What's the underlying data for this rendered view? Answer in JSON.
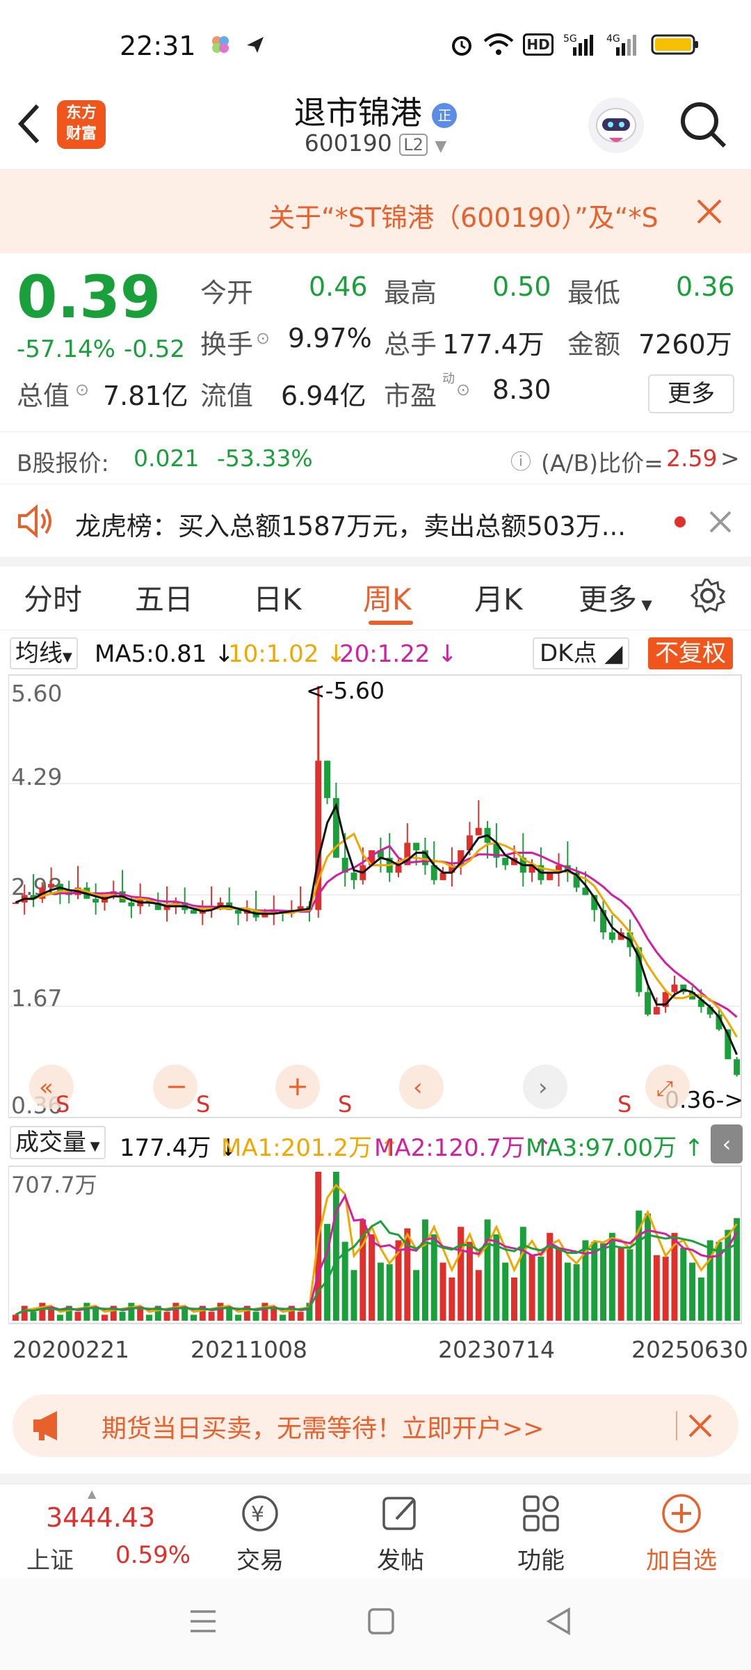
{
  "status": {
    "time": "22:31"
  },
  "header": {
    "title": "退市锦港",
    "title_badge": "正",
    "code": "600190",
    "level_badge": "L2",
    "logo_line1": "东方",
    "logo_line2": "财富"
  },
  "notice": {
    "text": "关于“*ST锦港（600190）”及“*S"
  },
  "quote": {
    "price": "0.39",
    "change_pct": "-57.14%",
    "change_abs": "-0.52",
    "open_label": "今开",
    "open": "0.46",
    "high_label": "最高",
    "high": "0.50",
    "low_label": "最低",
    "low": "0.36",
    "turnover_label": "换手",
    "turnover": "9.97%",
    "volume_label": "总手",
    "volume": "177.4万",
    "amount_label": "金额",
    "amount": "7260万",
    "mktcap_label": "总值",
    "mktcap": "7.81亿",
    "float_label": "流值",
    "float": "6.94亿",
    "pe_label": "市盈",
    "pe_sup": "动",
    "pe": "8.30",
    "more": "更多"
  },
  "bshare": {
    "label": "B股报价:",
    "price": "0.021",
    "pct": "-53.33%",
    "ratio_label": "(A/B)比价=",
    "ratio": "2.59",
    "arrow": ">"
  },
  "dragon": {
    "text": "龙虎榜：买入总额1587万元，卖出总额503万..."
  },
  "tabs": [
    "分时",
    "五日",
    "日K",
    "周K",
    "月K",
    "更多"
  ],
  "ma": {
    "selector": "均线",
    "ma5": "MA5:0.81",
    "ma10": "10:1.02",
    "ma20": "20:1.22",
    "dk": "DK点",
    "adjust": "不复权"
  },
  "chart_labels": {
    "y_top": "5.60",
    "y2": "4.29",
    "y3": "2.98",
    "y4": "1.67",
    "y_bot": "0.36",
    "peak": "<-5.60",
    "trough": "0.36->",
    "s_marker": "S"
  },
  "vol": {
    "selector": "成交量",
    "value": "177.4万",
    "ma1": "MA1:201.2万",
    "ma2": "MA2:120.7万",
    "ma3": "MA3:97.00万",
    "max": "707.7万"
  },
  "dates": [
    "20200221",
    "20211008",
    "20230714",
    "20250630"
  ],
  "ad": {
    "text": "期货当日买卖，无需等待！立即开户>>"
  },
  "index": {
    "value": "3444.43",
    "name": "上证",
    "pct": "0.59%"
  },
  "nav": [
    "交易",
    "发帖",
    "功能",
    "加自选"
  ],
  "colors": {
    "accent": "#e8602c",
    "up": "#e0302b",
    "down": "#1aa03a",
    "ma5": "#111111",
    "ma10": "#f0a800",
    "ma20": "#d01fa0"
  },
  "chart_data": {
    "type": "candlestick",
    "title": "退市锦港 周K",
    "ylim": [
      0.36,
      5.6
    ],
    "y_ticks": [
      5.6,
      4.29,
      2.98,
      1.67,
      0.36
    ],
    "x_ticks": [
      "20200221",
      "20211008",
      "20230714",
      "20250630"
    ],
    "series": [
      {
        "name": "close",
        "values": [
          2.7,
          2.8,
          2.75,
          2.9,
          2.95,
          2.85,
          2.8,
          2.9,
          2.75,
          2.7,
          2.8,
          2.85,
          2.7,
          2.65,
          2.75,
          2.7,
          2.6,
          2.65,
          2.7,
          2.6,
          2.55,
          2.6,
          2.65,
          2.7,
          2.6,
          2.55,
          2.6,
          2.5,
          2.55,
          2.6,
          2.55,
          2.6,
          2.65,
          2.6,
          4.6,
          4.1,
          3.3,
          3.1,
          3.0,
          3.2,
          3.4,
          3.3,
          3.1,
          3.2,
          3.5,
          3.4,
          3.2,
          3.0,
          3.1,
          3.2,
          3.4,
          3.6,
          3.7,
          3.5,
          3.3,
          3.2,
          3.3,
          3.1,
          3.2,
          3.0,
          3.1,
          3.2,
          3.1,
          2.9,
          2.8,
          2.6,
          2.3,
          2.2,
          2.3,
          2.1,
          1.5,
          1.2,
          1.3,
          1.5,
          1.6,
          1.5,
          1.4,
          1.3,
          1.2,
          1.0,
          0.6,
          0.39
        ]
      },
      {
        "name": "MA5",
        "values": [
          2.8,
          0.81
        ]
      },
      {
        "name": "MA10",
        "values": [
          2.8,
          1.02
        ]
      },
      {
        "name": "MA20",
        "values": [
          2.8,
          1.22
        ]
      }
    ]
  }
}
